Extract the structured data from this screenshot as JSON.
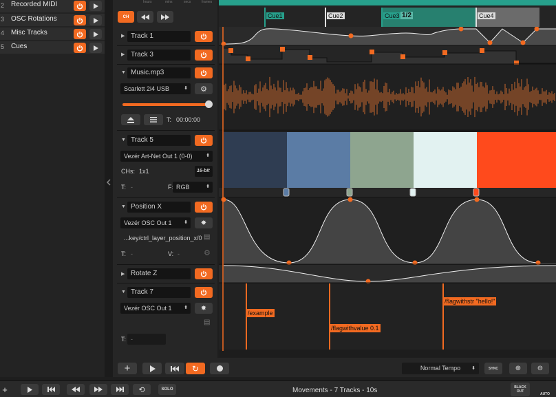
{
  "sidebar": {
    "items": [
      {
        "num": "2",
        "label": "Recorded MIDI"
      },
      {
        "num": "3",
        "label": "OSC Rotations"
      },
      {
        "num": "4",
        "label": "Misc Tracks"
      },
      {
        "num": "5",
        "label": "Cues"
      }
    ]
  },
  "timecode_labels": [
    "hours",
    "mins",
    "secs",
    "frames"
  ],
  "cues": [
    "Cue1",
    "Cue2",
    "Cue3",
    "1/2",
    "Cue4"
  ],
  "tracks": {
    "track1": "Track 1",
    "track3": "Track 3",
    "music": {
      "name": "Music.mp3",
      "device": "Scarlett 2i4 USB",
      "time_label": "T:",
      "time": "00:00:00"
    },
    "track5": {
      "name": "Track 5",
      "output": "Vezér Art-Net Out 1 (0-0)",
      "chs_label": "CHs:",
      "chs": "1x1",
      "bitdepth": "16-bit",
      "t_label": "T:",
      "t_value": "-",
      "f_label": "F:",
      "format": "RGB"
    },
    "position_x": {
      "name": "Position X",
      "output": "Vezér OSC Out 1",
      "address": "...key/ctrl_layer_position_x/0",
      "t_label": "T:",
      "t_value": "-",
      "v_label": "V:",
      "v_value": "-"
    },
    "rotate_z": "Rotate Z",
    "track7": {
      "name": "Track 7",
      "output": "Vezér OSC Out 1",
      "t_label": "T:",
      "t_value": "-"
    }
  },
  "color_segments": [
    "#2f3d52",
    "#5b7ca5",
    "#8ea58f",
    "#e2f2f1",
    "#ff4a1c"
  ],
  "osc_flags": [
    "/example",
    "/flagwithvalue 0.1",
    "/flagwithstr \"hello!\""
  ],
  "bottom_bar": {
    "tempo": "Normal Tempo",
    "sync": "SYNC",
    "status": "Movements - 7 Tracks - 10s",
    "solo": "SOLO",
    "blackout": "BLACK OUT",
    "auto": "AUTO"
  },
  "colors": {
    "accent": "#f26a21",
    "cue_teal": "#27a08c",
    "cue_gray": "#9a9a9a"
  }
}
